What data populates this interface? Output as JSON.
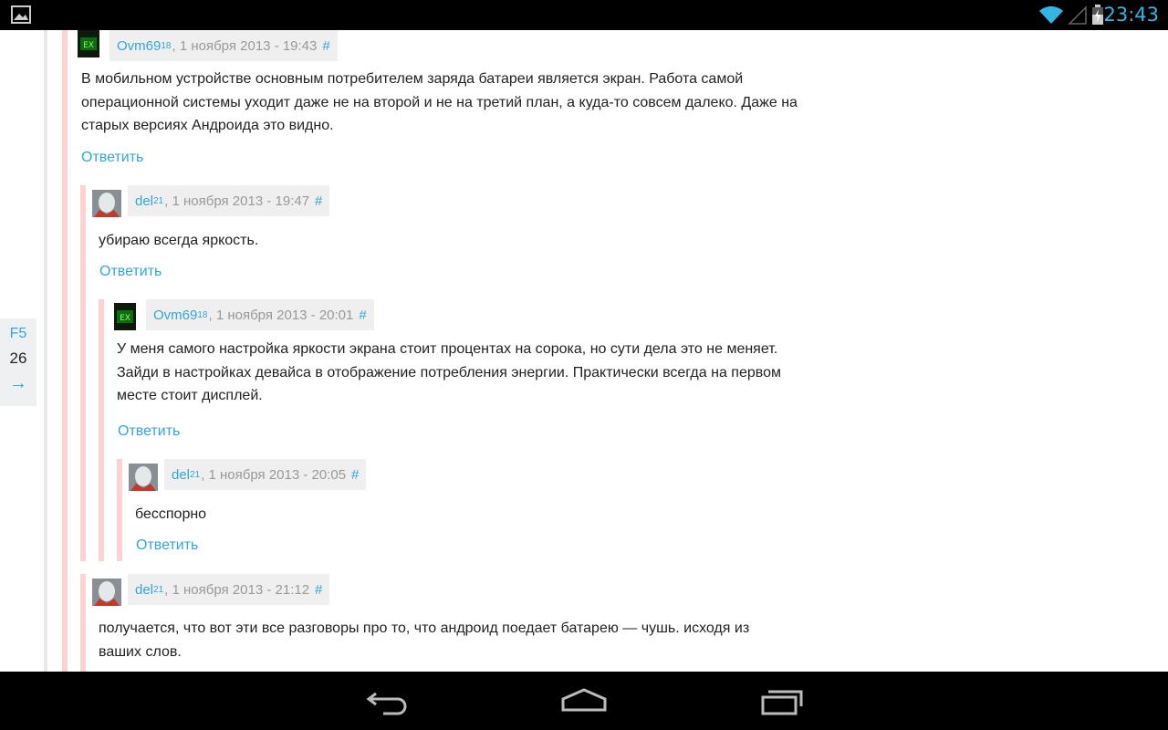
{
  "status_bar": {
    "time": "23:43",
    "icons": [
      "gallery-icon",
      "wifi-icon",
      "signal-icon",
      "battery-charging-icon"
    ]
  },
  "side_panel": {
    "refresh_label": "F5",
    "count": "26",
    "next_arrow": "→"
  },
  "comments": [
    {
      "author": "Ovm69",
      "karma": "18",
      "date": ", 1 ноября 2013 - 19:43",
      "anchor": "#",
      "text": "В мобильном устройстве основным потребителем заряда батареи является экран. Работа самой операционной системы уходит даже не на второй и не на третий план, а куда-то совсем далеко. Даже на старых версиях Андроида это видно.",
      "reply": "Ответить"
    },
    {
      "author": "del",
      "karma": "21",
      "date": ", 1 ноября 2013 - 19:47",
      "anchor": "#",
      "text": "убираю всегда яркость.",
      "reply": "Ответить"
    },
    {
      "author": "Ovm69",
      "karma": "18",
      "date": ", 1 ноября 2013 - 20:01",
      "anchor": "#",
      "text": "У меня самого настройка яркости экрана стоит процентах на сорока, но сути дела это не меняет. Зайди в настройках девайса в отображение потребления энергии. Практически всегда на первом месте стоит дисплей.",
      "reply": "Ответить"
    },
    {
      "author": "del",
      "karma": "21",
      "date": ", 1 ноября 2013 - 20:05",
      "anchor": "#",
      "text": "бесспорно",
      "reply": "Ответить"
    },
    {
      "author": "del",
      "karma": "21",
      "date": ", 1 ноября 2013 - 21:12",
      "anchor": "#",
      "text": "получается, что вот эти все разговоры про то, что андроид поедает батарею — чушь. исходя из ваших слов."
    }
  ],
  "nav_bar": {
    "buttons": [
      "back-icon",
      "home-icon",
      "recent-apps-icon"
    ]
  }
}
